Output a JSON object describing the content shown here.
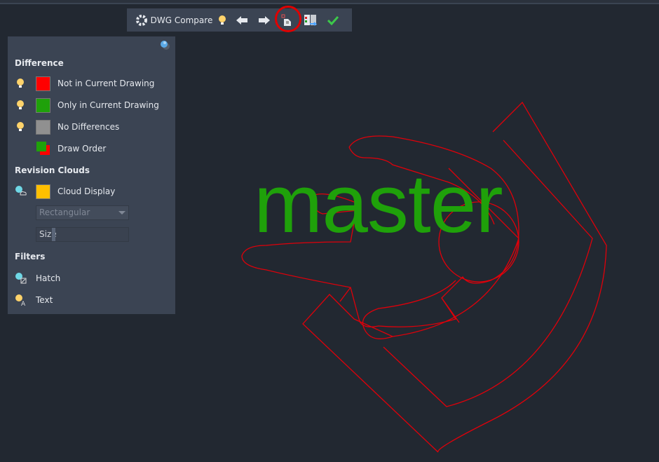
{
  "toolbar": {
    "title": "DWG Compare",
    "icons": [
      "settings-gear-icon",
      "lightbulb-icon",
      "previous-arrow-icon",
      "next-arrow-icon",
      "export-snapshot-icon",
      "compare-import-icon",
      "done-check-icon"
    ]
  },
  "panel": {
    "difference": {
      "heading": "Difference",
      "items": [
        {
          "label": "Not in Current Drawing",
          "color": "#ff0000"
        },
        {
          "label": "Only in Current Drawing",
          "color": "#1fa10a"
        },
        {
          "label": "No Differences",
          "color": "#909090"
        },
        {
          "label": "Draw Order"
        }
      ]
    },
    "revision_clouds": {
      "heading": "Revision Clouds",
      "cloud_display": {
        "label": "Cloud Display",
        "color": "#ffbf00"
      },
      "shape_select": "Rectangular",
      "size_label": "Size"
    },
    "filters": {
      "heading": "Filters",
      "items": [
        {
          "label": "Hatch"
        },
        {
          "label": "Text"
        }
      ]
    }
  },
  "canvas": {
    "text": "master",
    "text_color": "#1fa10a",
    "geometry_color": "#e0000a"
  }
}
